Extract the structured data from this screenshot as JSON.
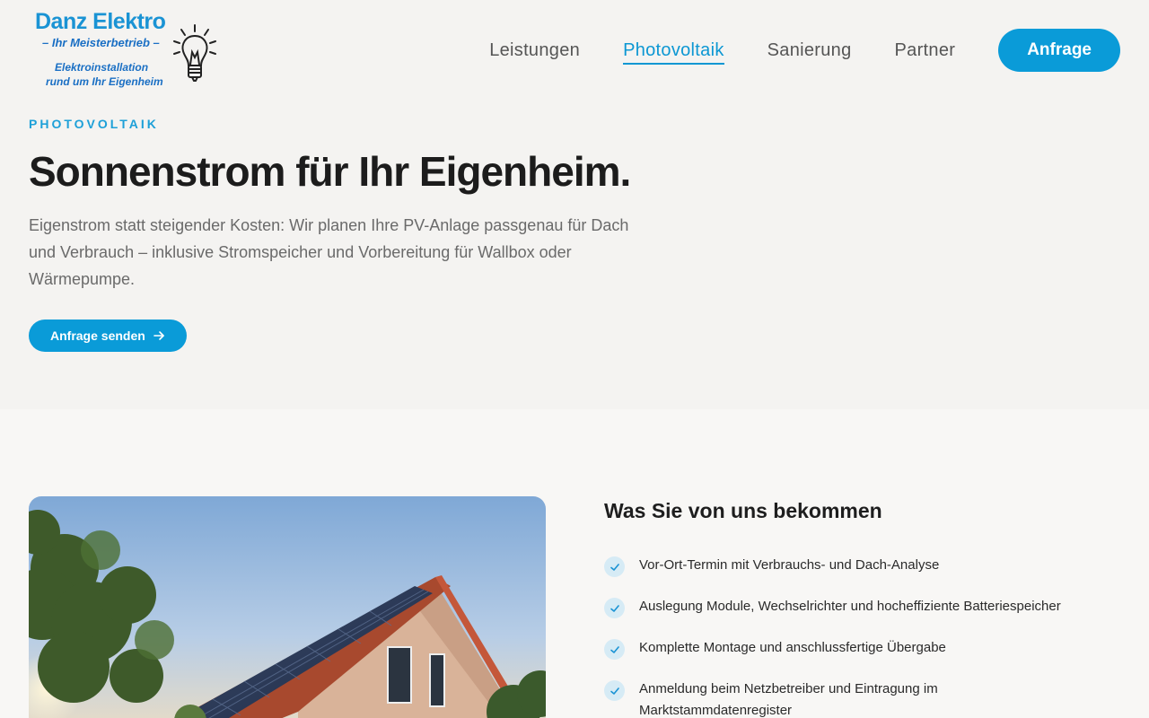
{
  "logo": {
    "name": "Danz Elektro",
    "tagline": "– Ihr Meisterbetrieb –",
    "line1": "Elektroinstallation",
    "line2": "rund um Ihr Eigenheim"
  },
  "nav": {
    "items": [
      {
        "label": "Leistungen",
        "active": false
      },
      {
        "label": "Photovoltaik",
        "active": true
      },
      {
        "label": "Sanierung",
        "active": false
      },
      {
        "label": "Partner",
        "active": false
      }
    ],
    "cta_label": "Anfrage"
  },
  "hero": {
    "eyebrow": "PHOTOVOLTAIK",
    "title": "Sonnenstrom für Ihr Eigenheim.",
    "text": "Eigenstrom statt steigender Kosten: Wir planen Ihre PV-Anlage passgenau für Dach und Verbrauch – inklusive Stromspeicher und Vorbereitung für Wallbox oder Wärmepumpe.",
    "button_label": "Anfrage senden"
  },
  "benefits": {
    "title": "Was Sie von uns bekommen",
    "items": [
      "Vor-Ort-Termin mit Verbrauchs- und Dach-Analyse",
      "Auslegung Module, Wechselrichter und hocheffiziente Batteriespeicher",
      "Komplette Montage und anschlussfertige Übergabe",
      "Anmeldung beim Netzbetreiber und Eintragung im Marktstammdatenregister"
    ]
  },
  "colors": {
    "accent": "#0a9bd8",
    "background": "#f4f3f1",
    "check_bg": "#d6ebf5"
  }
}
